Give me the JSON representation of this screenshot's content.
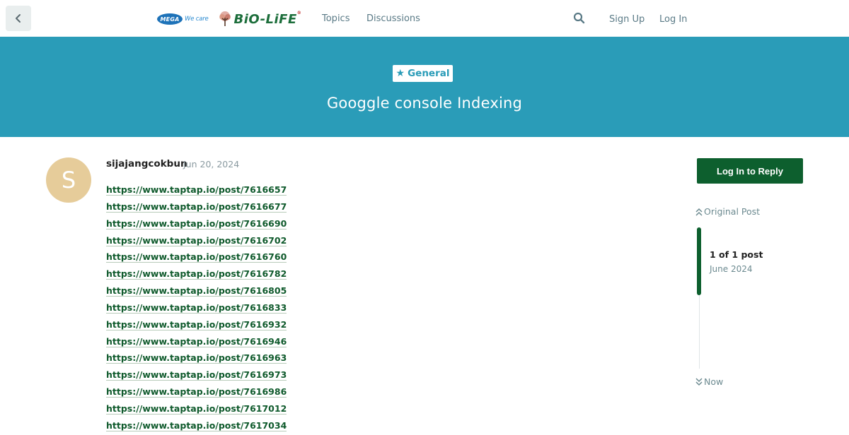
{
  "header": {
    "logo": {
      "mega_text": "MEGA",
      "wecare_text": "We care",
      "brand_text": "BiO-LiFE",
      "trademark": "®"
    },
    "nav": {
      "topics": "Topics",
      "discussions": "Discussions"
    },
    "sign_up": "Sign Up",
    "log_in": "Log In",
    "icons": {
      "back": "chevron-left-icon",
      "search": "search-icon"
    }
  },
  "banner": {
    "category": "General",
    "category_icon": "star-icon",
    "title": "Googgle console Indexing",
    "color": "#2a9cb8"
  },
  "post": {
    "avatar_letter": "S",
    "avatar_color": "#e6cc9a",
    "username": "sijajangcokbun",
    "date": "Jun 20, 2024",
    "links": [
      "https://www.taptap.io/post/7616657",
      "https://www.taptap.io/post/7616677",
      "https://www.taptap.io/post/7616690",
      "https://www.taptap.io/post/7616702",
      "https://www.taptap.io/post/7616760",
      "https://www.taptap.io/post/7616782",
      "https://www.taptap.io/post/7616805",
      "https://www.taptap.io/post/7616833",
      "https://www.taptap.io/post/7616932",
      "https://www.taptap.io/post/7616946",
      "https://www.taptap.io/post/7616963",
      "https://www.taptap.io/post/7616973",
      "https://www.taptap.io/post/7616986",
      "https://www.taptap.io/post/7617012",
      "https://www.taptap.io/post/7617034"
    ]
  },
  "sidebar": {
    "reply_button": "Log In to Reply",
    "original_post": "Original Post",
    "post_count": "1 of 1 post",
    "post_month": "June 2024",
    "now": "Now",
    "accent_color": "#0d5f2e"
  }
}
